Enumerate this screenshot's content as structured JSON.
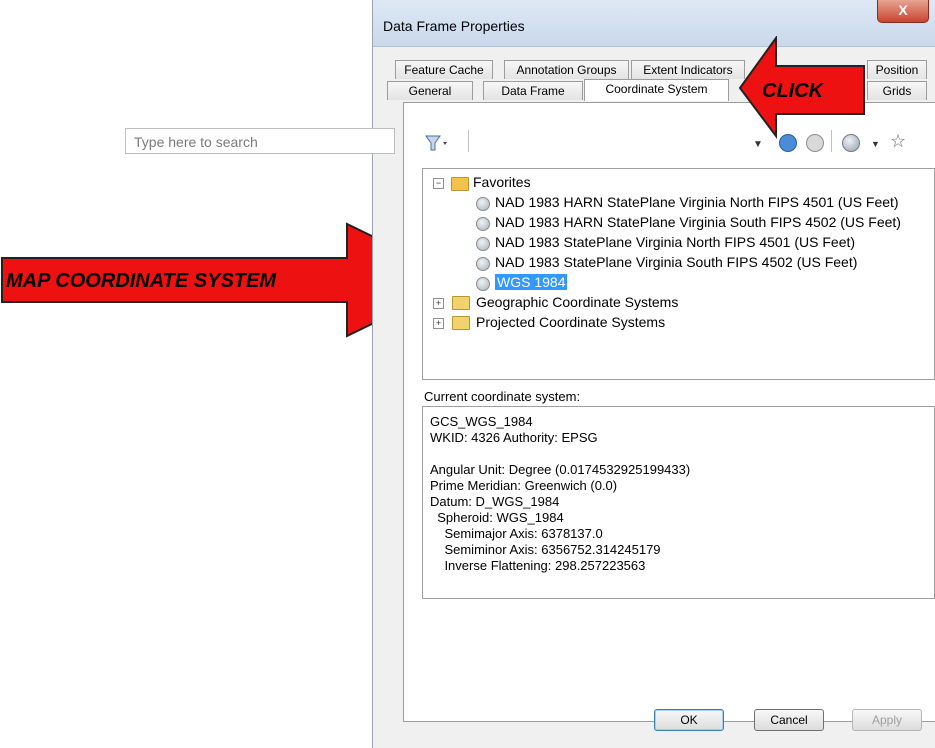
{
  "window": {
    "title": "Data Frame Properties",
    "close_glyph": "X"
  },
  "tabs": {
    "row1": [
      "Feature Cache",
      "Annotation Groups",
      "Extent Indicators",
      "Position"
    ],
    "row2": [
      "General",
      "Data Frame",
      "Coordinate System",
      "Grids"
    ],
    "active": "Coordinate System"
  },
  "toolbar": {
    "filter_icon": "filter-icon",
    "search_placeholder": "Type here to search",
    "icons": [
      "search-icon",
      "clear-search-icon",
      "globe-icon",
      "add-favorite-icon"
    ]
  },
  "tree": {
    "favorites_label": "Favorites",
    "favorites": [
      "NAD 1983 HARN StatePlane Virginia North FIPS 4501 (US Feet)",
      "NAD 1983 HARN StatePlane Virginia South FIPS 4502 (US Feet)",
      "NAD 1983 StatePlane Virginia North FIPS 4501 (US Feet)",
      "NAD 1983 StatePlane Virginia South FIPS 4502 (US Feet)",
      "WGS 1984"
    ],
    "selected": "WGS 1984",
    "folders": [
      "Geographic Coordinate Systems",
      "Projected Coordinate Systems"
    ]
  },
  "current": {
    "label": "Current coordinate system:",
    "lines": [
      "GCS_WGS_1984",
      "WKID: 4326 Authority: EPSG",
      "",
      "Angular Unit: Degree (0.0174532925199433)",
      "Prime Meridian: Greenwich (0.0)",
      "Datum: D_WGS_1984",
      "  Spheroid: WGS_1984",
      "    Semimajor Axis: 6378137.0",
      "    Semiminor Axis: 6356752.314245179",
      "    Inverse Flattening: 298.257223563"
    ]
  },
  "buttons": {
    "ok": "OK",
    "cancel": "Cancel",
    "apply": "Apply"
  },
  "annotations": {
    "left_arrow": "MAP COORDINATE SYSTEM",
    "top_arrow": "CLICK",
    "arrow_color": "#ee1111"
  }
}
